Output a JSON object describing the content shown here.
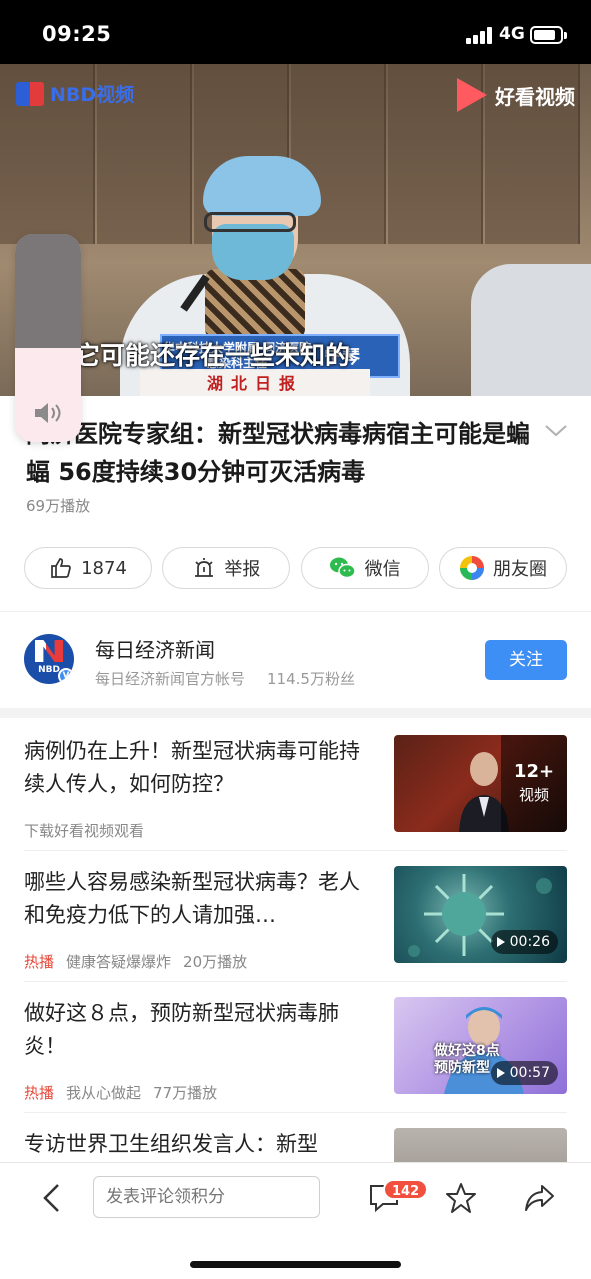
{
  "status_bar": {
    "time": "09:25",
    "network": "4G"
  },
  "video": {
    "logo_left": "NBD视频",
    "logo_right": "好看视频",
    "nameplate_org": "华中科技大学附属 同济医院感染科主任",
    "nameplate_name": "宁琴",
    "subtitle": "它可能还存在一些未知的",
    "desk_plate": "湖北日报",
    "volume_level": 0.45
  },
  "article": {
    "title": "同济医院专家组：新型冠状病毒病宿主可能是蝙蝠 56度持续30分钟可灭活病毒",
    "plays": "69万播放"
  },
  "actions": [
    {
      "label": "1874",
      "icon": "thumbs-up-icon"
    },
    {
      "label": "举报",
      "icon": "report-icon"
    },
    {
      "label": "微信",
      "icon": "wechat-icon"
    },
    {
      "label": "朋友圈",
      "icon": "moments-icon"
    }
  ],
  "channel": {
    "name": "每日经济新闻",
    "description": "每日经济新闻官方帐号",
    "fans": "114.5万粉丝",
    "follow_label": "关注",
    "avatar_text": "NBD"
  },
  "feed": [
    {
      "title": "病例仍在上升！新型冠状病毒可能持续人传人，如何防控？",
      "tag": "",
      "source": "下载好看视频观看",
      "plays": "",
      "overlay_count": "12+",
      "overlay_label": "视频",
      "duration": ""
    },
    {
      "title": "哪些人容易感染新型冠状病毒？老人和免疫力低下的人请加强…",
      "tag": "热播",
      "source": "健康答疑爆爆炸",
      "plays": "20万播放",
      "duration": "00:26"
    },
    {
      "title": "做好这８点，预防新型冠状病毒肺炎！",
      "tag": "热播",
      "source": "我从心做起",
      "plays": "77万播放",
      "duration": "00:57",
      "thumb_caption_1": "做好这8点",
      "thumb_caption_2": "预防新型"
    },
    {
      "title": "专访世界卫生组织发言人：新型"
    }
  ],
  "bottom_bar": {
    "comment_placeholder": "发表评论领积分",
    "comment_count": "142"
  },
  "colors": {
    "accent": "#3d8ef5",
    "hot": "#e84a3b",
    "badge": "#f2503f"
  }
}
